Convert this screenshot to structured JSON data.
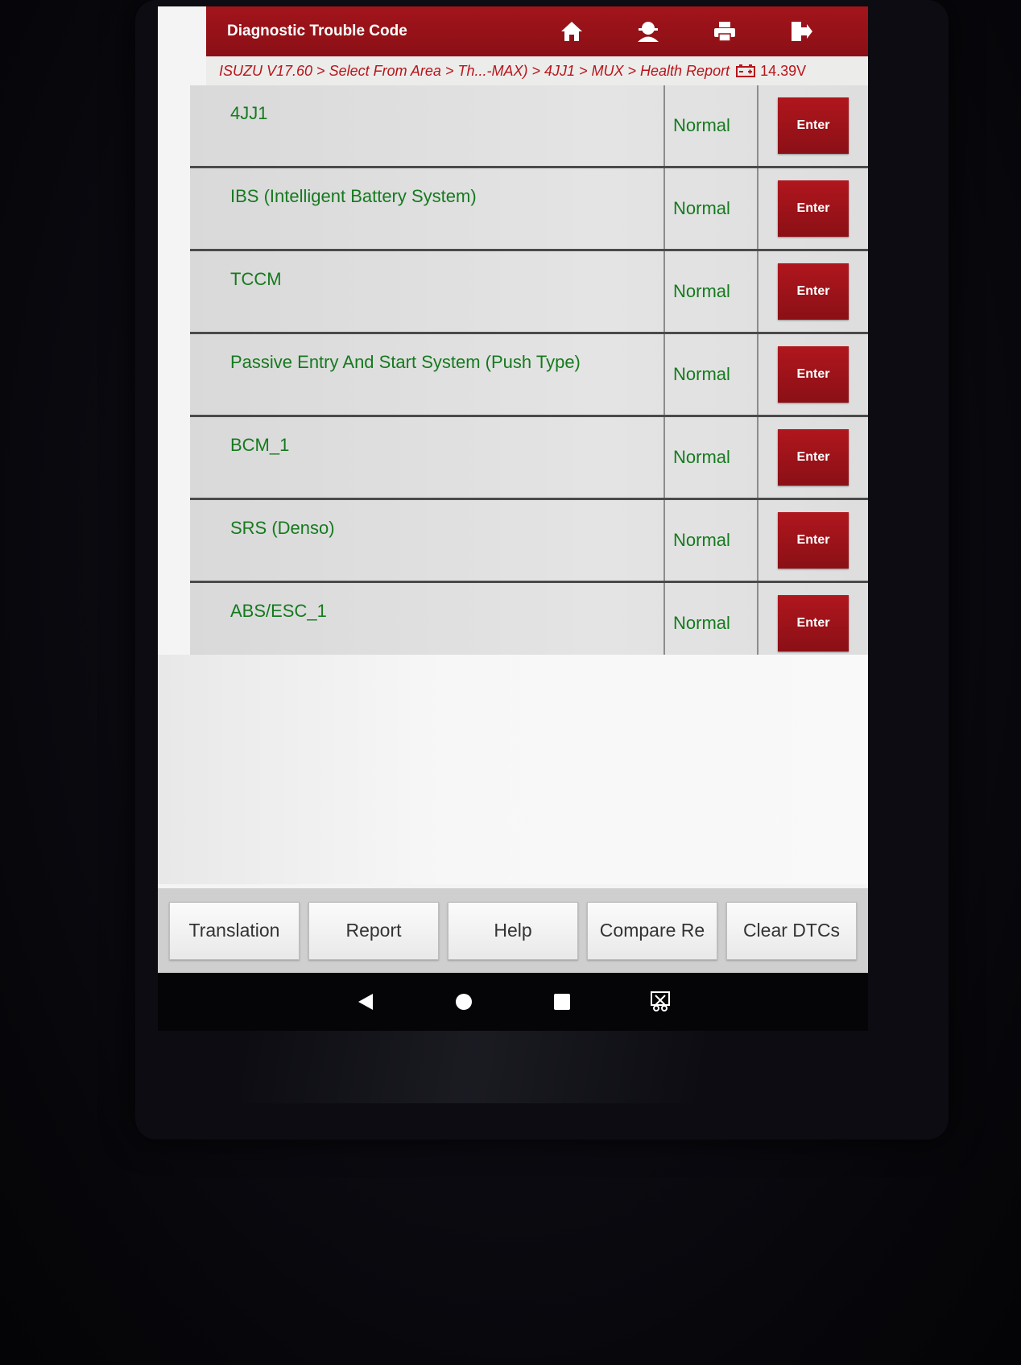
{
  "header": {
    "title": "Diagnostic Trouble Code",
    "icons": [
      "home-icon",
      "user-icon",
      "print-icon",
      "exit-icon"
    ],
    "accent_color": "#9a1218"
  },
  "breadcrumb": {
    "path": "ISUZU V17.60 > Select From Area > Th...-MAX) > 4JJ1 > MUX > Health Report",
    "voltage": "14.39V"
  },
  "systems": [
    {
      "name": "4JJ1",
      "status": "Normal",
      "action": "Enter"
    },
    {
      "name": "IBS (Intelligent Battery System)",
      "status": "Normal",
      "action": "Enter"
    },
    {
      "name": "TCCM",
      "status": "Normal",
      "action": "Enter"
    },
    {
      "name": "Passive Entry And Start System (Push Type)",
      "status": "Normal",
      "action": "Enter"
    },
    {
      "name": "BCM_1",
      "status": "Normal",
      "action": "Enter"
    },
    {
      "name": "SRS (Denso)",
      "status": "Normal",
      "action": "Enter"
    },
    {
      "name": "ABS/ESC_1",
      "status": "Normal",
      "action": "Enter"
    }
  ],
  "toolbar": {
    "translation": "Translation",
    "report": "Report",
    "help": "Help",
    "compare": "Compare Re",
    "clear_dtcs": "Clear DTCs"
  },
  "status_color": "#157a1e"
}
